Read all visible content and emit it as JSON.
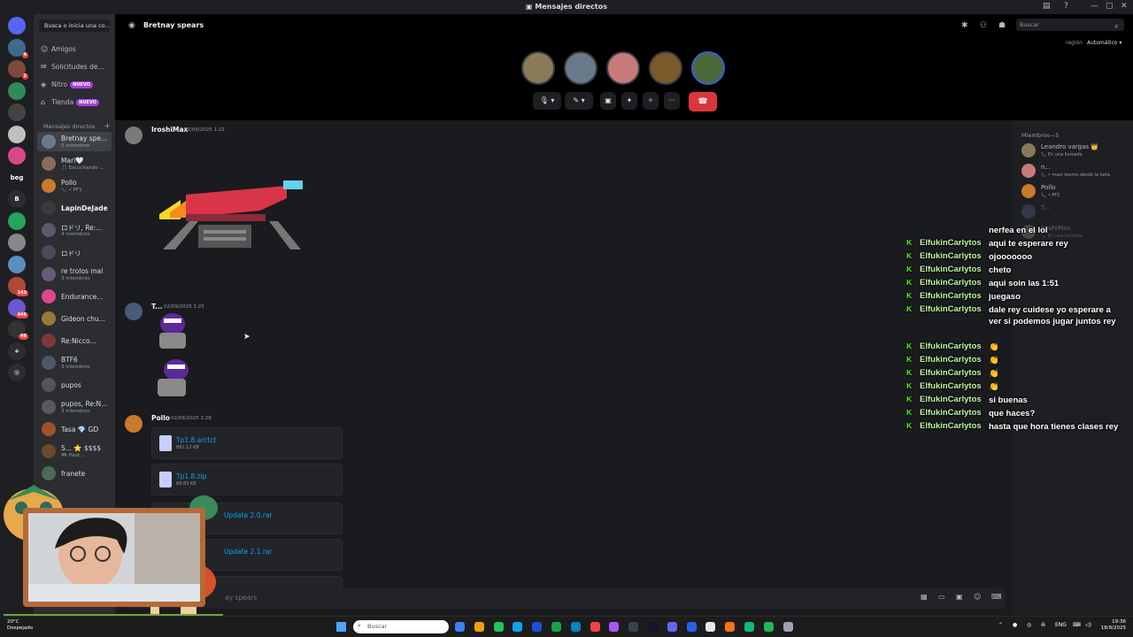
{
  "window": {
    "title": "Mensajes directos",
    "controls": [
      "—",
      "▢",
      "✕"
    ]
  },
  "colors": {
    "accent": "#5865f2",
    "nitro_badge": "#a441e0",
    "hangup": "#da373c",
    "link": "#00a8fc",
    "kick_green": "#53fc18"
  },
  "servers": [
    {
      "label": "",
      "color": "#5865f2",
      "icon": "discord-icon"
    },
    {
      "label": "",
      "color": "#3d6b8c",
      "badge": "4"
    },
    {
      "label": "",
      "color": "#7c4a3a",
      "badge": "2"
    },
    {
      "label": "",
      "color": "#2e8b57"
    },
    {
      "label": "",
      "color": "#444"
    },
    {
      "label": "",
      "color": "#c0c0c0"
    },
    {
      "label": "",
      "color": "#d64a8a"
    },
    {
      "label": "beg",
      "color": "#1e1f22"
    },
    {
      "label": "B",
      "color": "#2b2d31"
    },
    {
      "label": "",
      "color": "#23a55a"
    },
    {
      "label": "",
      "color": "#888"
    },
    {
      "label": "",
      "color": "#5a8fbf"
    },
    {
      "label": "",
      "color": "#b0483a",
      "badge": "143"
    },
    {
      "label": "",
      "color": "#6a5acd",
      "badge": "446"
    },
    {
      "label": "",
      "color": "#333",
      "badge": "48"
    },
    {
      "label": "+",
      "color": "#2b2d31"
    },
    {
      "label": "◎",
      "color": "#2b2d31"
    }
  ],
  "dm_sidebar": {
    "search_placeholder": "Busca o inicia una co...",
    "nav": [
      {
        "label": "Amigos",
        "icon": "friends-icon"
      },
      {
        "label": "Solicitudes de...",
        "icon": "requests-icon"
      },
      {
        "label": "Nitro",
        "icon": "nitro-icon",
        "badge": "NUEVO"
      },
      {
        "label": "Tienda",
        "icon": "shop-icon",
        "badge": "NUEVO"
      }
    ],
    "section_title": "Mensajes directos",
    "section_add": "+",
    "dms": [
      {
        "name": "Bretnay spe...",
        "sub": "5 miembros",
        "color": "#6b7b8c",
        "active": true
      },
      {
        "name": "Mari🤍",
        "sub": "🎵 Escuchando ...",
        "color": "#8c6a5a"
      },
      {
        "name": "Pollo",
        "sub": "📞 • PF1",
        "color": "#c97a2a"
      },
      {
        "name": "LapinDeJade",
        "sub": "",
        "color": "#3a3a3a",
        "bright": true
      },
      {
        "name": "ロドリ, Re:...",
        "sub": "4 miembros",
        "color": "#5a5a6a"
      },
      {
        "name": "ロドリ",
        "sub": "",
        "color": "#4a4a5a"
      },
      {
        "name": "re trolos mal",
        "sub": "3 miembros",
        "color": "#6a5a7a"
      },
      {
        "name": "Endurance...",
        "sub": "",
        "color": "#e0468c"
      },
      {
        "name": "Gideon chu...",
        "sub": "",
        "color": "#9a7a3a"
      },
      {
        "name": "Re:Nicco...",
        "sub": "",
        "color": "#7a3a3a"
      },
      {
        "name": "BTF6",
        "sub": "3 miembros",
        "color": "#4a5a6a"
      },
      {
        "name": "pupos",
        "sub": "",
        "color": "#555"
      },
      {
        "name": "pupos, Re:N...",
        "sub": "3 miembros",
        "color": "#5a5a5a"
      },
      {
        "name": "Tasa 💎 GD",
        "sub": "",
        "color": "#a0522d"
      },
      {
        "name": "S... ⭐ $$$$",
        "sub": "🎮 Host...",
        "color": "#6a4a2a"
      },
      {
        "name": "franete",
        "sub": "",
        "color": "#4a6a5a"
      }
    ]
  },
  "header": {
    "channel_name": "Bretnay spears",
    "search_placeholder": "Buscar",
    "region_label": "región",
    "region_value": "Automático ▾",
    "call_participants": [
      {
        "color": "#8a7a5a"
      },
      {
        "color": "#6a7a8a"
      },
      {
        "color": "#c87a7a"
      },
      {
        "color": "#7a5a2a"
      },
      {
        "color": "#4a6a3a"
      }
    ],
    "call_controls": [
      {
        "icon": "mic-icon",
        "glyph": "🎙 ▾"
      },
      {
        "icon": "camera-off-icon",
        "glyph": "✎ ▾"
      },
      {
        "icon": "screenshare-icon",
        "glyph": "▣"
      },
      {
        "icon": "activity-icon",
        "glyph": "✦"
      },
      {
        "icon": "soundboard-icon",
        "glyph": "✧"
      },
      {
        "icon": "more-icon",
        "glyph": "···"
      }
    ],
    "hangup_glyph": "☎"
  },
  "messages": [
    {
      "author": "IroshiMax",
      "timestamp": "02/09/2025 1:22",
      "color": "#7a7a7a"
    },
    {
      "author": "T...",
      "timestamp": "02/09/2025 1:25",
      "color": "#4a5a7a"
    },
    {
      "author": "Pollo",
      "timestamp": "02/09/2025 1:28",
      "color": "#c97a2a",
      "attachments": [
        {
          "name": "Tp1.8.arctct",
          "size": "891.12 KB"
        },
        {
          "name": "Tp1.8.zip",
          "size": "68.83 KB"
        },
        {
          "name": "Update 2.0.rar",
          "size": ""
        },
        {
          "name": "Update 2.1.rar",
          "size": ""
        },
        {
          "name": "",
          "size": ""
        }
      ]
    }
  ],
  "chat_input": {
    "placeholder": "ay spears"
  },
  "members": {
    "title": "Miembros—5",
    "list": [
      {
        "name": "Leandro vargas 👑",
        "sub": "📞 En una llamada",
        "color": "#8a7a5a"
      },
      {
        "name": "n...",
        "sub": "📞 • maxi teemo desde la beta",
        "color": "#c87a7a"
      },
      {
        "name": "Pollo",
        "sub": "📞 • PF1",
        "color": "#c97a2a"
      },
      {
        "name": "T...",
        "sub": "",
        "color": "#4a5a7a"
      },
      {
        "name": "IroshiMax",
        "sub": "📞 En una llamada",
        "color": "#7a7a7a"
      }
    ]
  },
  "stream_chat": [
    {
      "user": "",
      "text": "nerfea en el lol"
    },
    {
      "user": "ElfukinCarlytos",
      "text": "aqui te esperare rey"
    },
    {
      "user": "ElfukinCarlytos",
      "text": "ojooooooo"
    },
    {
      "user": "ElfukinCarlytos",
      "text": "cheto"
    },
    {
      "user": "ElfukinCarlytos",
      "text": "aqui soin las 1:51"
    },
    {
      "user": "ElfukinCarlytos",
      "text": "juegaso"
    },
    {
      "user": "ElfukinCarlytos",
      "text": "dale rey cuidese yo esperare a ver si podemos jugar juntos rey"
    },
    {
      "user": "ElfukinCarlytos",
      "text": "👏"
    },
    {
      "user": "ElfukinCarlytos",
      "text": "👏"
    },
    {
      "user": "ElfukinCarlytos",
      "text": "👏"
    },
    {
      "user": "ElfukinCarlytos",
      "text": "👏"
    },
    {
      "user": "ElfukinCarlytos",
      "text": "si buenas"
    },
    {
      "user": "ElfukinCarlytos",
      "text": "que haces?"
    },
    {
      "user": "ElfukinCarlytos",
      "text": "hasta que hora tienes clases rey"
    }
  ],
  "taskbar": {
    "weather_temp": "20°C",
    "weather_desc": "Despejado",
    "search_placeholder": "Buscar",
    "lang": "ENG",
    "time": "19:36",
    "date": "18/9/2025",
    "apps": [
      "#3b82f6",
      "#f59e0b",
      "#22c55e",
      "#0ea5e9",
      "#1d4ed8",
      "#16a34a",
      "#0284c7",
      "#ef4444",
      "#a855f7",
      "#374151",
      "#111827",
      "#6366f1",
      "#2563eb",
      "#e5e7eb",
      "#f97316",
      "#10b981",
      "#1db954",
      "#9ca3af"
    ]
  }
}
